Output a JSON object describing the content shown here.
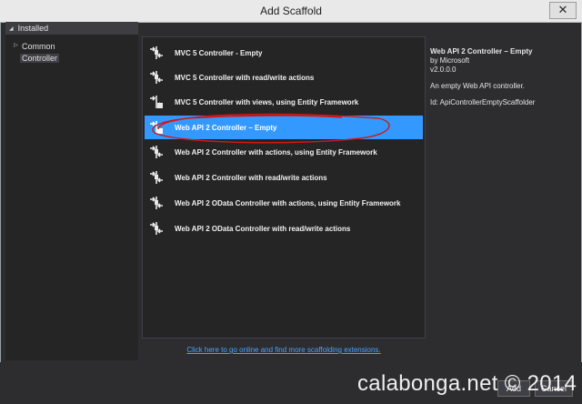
{
  "window": {
    "title": "Add Scaffold",
    "close_glyph": "✕"
  },
  "sidebar": {
    "header": "Installed",
    "items": [
      {
        "label": "Common"
      },
      {
        "label": "Controller"
      }
    ]
  },
  "list": {
    "items": [
      {
        "label": "MVC 5 Controller - Empty"
      },
      {
        "label": "MVC 5 Controller with read/write actions"
      },
      {
        "label": "MVC 5 Controller with views, using Entity Framework"
      },
      {
        "label": "Web API 2 Controller – Empty"
      },
      {
        "label": "Web API 2 Controller with actions, using Entity Framework"
      },
      {
        "label": "Web API 2 Controller with read/write actions"
      },
      {
        "label": "Web API 2 OData Controller with actions, using Entity Framework"
      },
      {
        "label": "Web API 2 OData Controller with read/write actions"
      }
    ],
    "selected_index": 3
  },
  "details": {
    "title": "Web API 2 Controller – Empty",
    "author": "by Microsoft",
    "version": "v2.0.0.0",
    "description": "An empty Web API controller.",
    "id": "Id: ApiControllerEmptyScaffolder"
  },
  "online_link": "Click here to go online and find more scaffolding extensions.",
  "buttons": {
    "add": "Add",
    "cancel": "Cancel"
  },
  "watermark": "calabonga.net © 2014",
  "colors": {
    "selection": "#3399ff",
    "annotation": "#d01818"
  }
}
